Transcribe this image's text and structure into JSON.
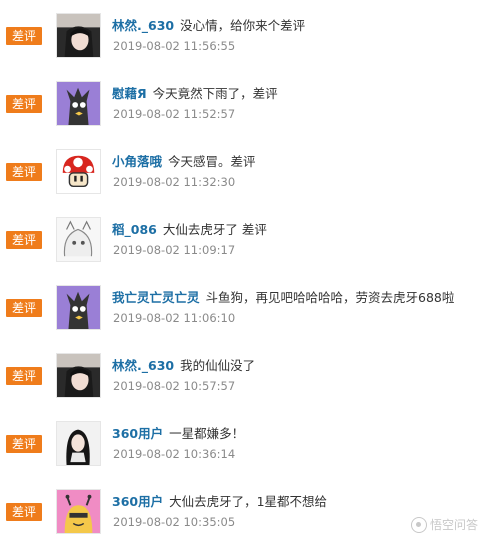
{
  "badge_label": "差评",
  "comments": [
    {
      "name": "林然._630",
      "text": "没心情，给你来个差评",
      "time": "2019-08-02 11:56:55",
      "avatar_icon": "photo-avatar-icon"
    },
    {
      "name": "慰藉Я",
      "text": "今天竟然下雨了，差评",
      "time": "2019-08-02 11:52:57",
      "avatar_icon": "purple-monster-avatar-icon"
    },
    {
      "name": "小角落哦",
      "text": "今天感冒。差评",
      "time": "2019-08-02 11:32:30",
      "avatar_icon": "mushroom-avatar-icon"
    },
    {
      "name": "稻_086",
      "text": "大仙去虎牙了 差评",
      "time": "2019-08-02 11:09:17",
      "avatar_icon": "sketch-avatar-icon"
    },
    {
      "name": "我亡灵亡灵亡灵",
      "text": "斗鱼狗，再见吧哈哈哈哈，劳资去虎牙688啦",
      "time": "2019-08-02 11:06:10",
      "avatar_icon": "purple-monster-avatar-icon"
    },
    {
      "name": "林然._630",
      "text": "我的仙仙没了",
      "time": "2019-08-02 10:57:57",
      "avatar_icon": "photo-avatar-icon"
    },
    {
      "name": "360用户",
      "text": "一星都嫌多！",
      "time": "2019-08-02 10:36:14",
      "avatar_icon": "girl-avatar-icon"
    },
    {
      "name": "360用户",
      "text": "大仙去虎牙了，1星都不想给",
      "time": "2019-08-02 10:35:05",
      "avatar_icon": "pink-character-avatar-icon"
    }
  ],
  "watermark": "悟空问答"
}
